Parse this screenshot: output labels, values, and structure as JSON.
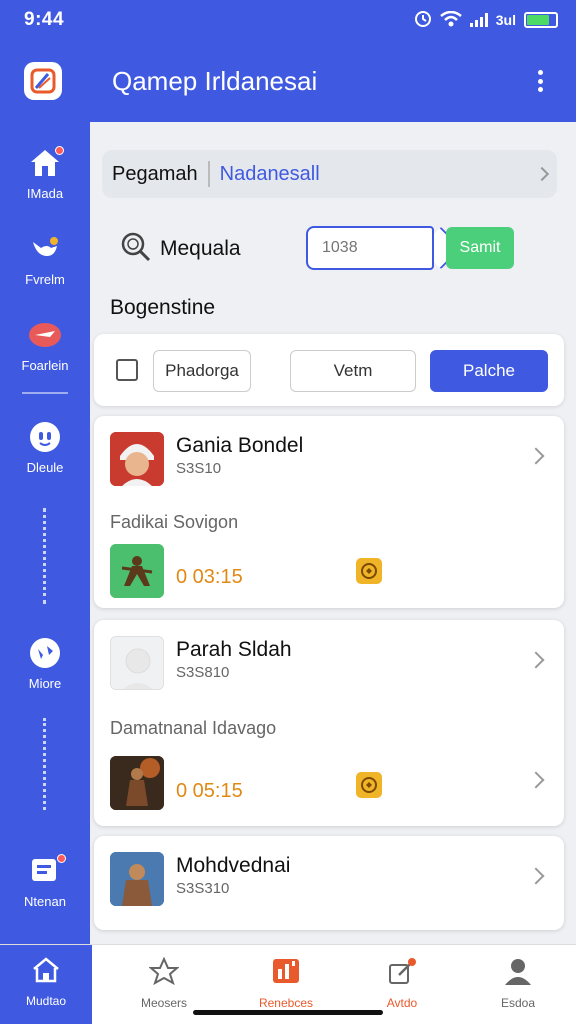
{
  "status_bar": {
    "time": "9:44",
    "carrier": "3ul"
  },
  "app_bar": {
    "title": "Qamep Irldanesai"
  },
  "sidebar": {
    "items": [
      {
        "label": "IMada",
        "icon": "home-icon"
      },
      {
        "label": "Fvrelm",
        "icon": "bird-icon"
      },
      {
        "label": "Foarlein",
        "icon": "plane-icon"
      },
      {
        "label": "Dleule",
        "icon": "face-icon"
      },
      {
        "label": "Miore",
        "icon": "globe-icon"
      },
      {
        "label": "Ntenan",
        "icon": "message-icon"
      }
    ]
  },
  "breadcrumb": {
    "primary": "Pegamah",
    "secondary": "Nadanesall"
  },
  "search": {
    "label": "Mequala",
    "placeholder": "1038",
    "submit_label": "Samit"
  },
  "section_title": "Bogenstine",
  "filters": [
    {
      "label": "Phadorga",
      "active": false
    },
    {
      "label": "Vetm",
      "active": false
    },
    {
      "label": "Palche",
      "active": true
    }
  ],
  "cards": [
    {
      "title": "Gania Bondel",
      "subtitle": "S3S10",
      "description": "Fadikai Sovigon",
      "value": "0 03:15"
    },
    {
      "title": "Parah Sldah",
      "subtitle": "S3S810",
      "description": "Damatnanal Idavago",
      "value": "0 05:15"
    },
    {
      "title": "Mohdvednai",
      "subtitle": "S3S310"
    }
  ],
  "bottom_nav": [
    {
      "label": "Mudtao",
      "icon": "home-icon"
    },
    {
      "label": "Meosers",
      "icon": "star-icon"
    },
    {
      "label": "Renebces",
      "icon": "chart-icon"
    },
    {
      "label": "Avtdo",
      "icon": "edit-icon"
    },
    {
      "label": "Esdoa",
      "icon": "profile-icon"
    }
  ],
  "colors": {
    "primary": "#3f5ae0",
    "accent_green": "#4ccf7a",
    "accent_orange": "#e08a16",
    "nav_red": "#e85a2b",
    "badge_red": "#ff5b5b"
  }
}
